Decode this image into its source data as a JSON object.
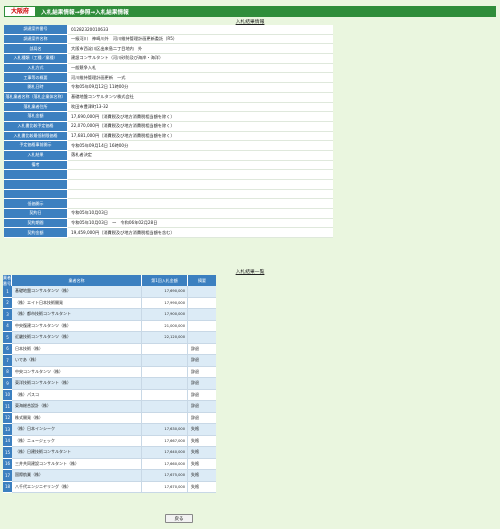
{
  "header": {
    "logo": "大阪府",
    "breadcrumb": "入札結果情報→参照→入札結果情報"
  },
  "detail": {
    "title": "入札結果情報",
    "rows": [
      {
        "label": "調達案件番号",
        "value": "01282320010633"
      },
      {
        "label": "調達案件名称",
        "value": "一級河川　神崎川外　河川維持管理計画更新委託（R5）"
      },
      {
        "label": "部局名",
        "value": "大阪市西淀川区出来島二丁目地内　外"
      },
      {
        "label": "入札種類（工種／業種）",
        "value": "建設コンサルタント（河川砂防及び海岸・海洋）"
      },
      {
        "label": "入札方式",
        "value": "一般競争入札"
      },
      {
        "label": "工事等の概要",
        "value": "河川維持管理計画更新　一式"
      },
      {
        "label": "開札日時",
        "value": "令和05年09月12日 11時00分"
      },
      {
        "label": "落札業者名称（落札企業体名称）",
        "value": "基礎地盤コンサルタンツ株式会社"
      },
      {
        "label": "落札業者住所",
        "value": "吹田市豊津町13-32"
      },
      {
        "label": "落札金額",
        "value": "17,690,000円（消費税及び地方消費税相当額を除く）"
      },
      {
        "label": "入札書比較予定価格",
        "value": "22,070,000円（消費税及び地方消費税相当額を除く）"
      },
      {
        "label": "入札書比較最低制限価格",
        "value": "17,681,000円（消費税及び地方消費税相当額を除く）"
      },
      {
        "label": "予定価格事前開示",
        "value": "令和05年09月14日 16時00分"
      },
      {
        "label": "入札結果",
        "value": "落札者決定"
      },
      {
        "label": "備考",
        "value": ""
      },
      {
        "label": "",
        "value": ""
      },
      {
        "label": "",
        "value": ""
      },
      {
        "label": "",
        "value": ""
      },
      {
        "label": "低価開示",
        "value": ""
      },
      {
        "label": "契約日",
        "value": "令和05年10月03日"
      },
      {
        "label": "契約期間",
        "value": "令和05年10月03日　～　令和06年02月28日"
      },
      {
        "label": "契約金額",
        "value": "19,459,000円（消費税及び地方消費税相当額を含む）"
      }
    ]
  },
  "results": {
    "title": "入札結果一覧",
    "headers": {
      "no": "業者番号",
      "name": "業者名称",
      "amount": "第1回入札金額",
      "summary": "摘要"
    },
    "rows": [
      {
        "no": "1",
        "name": "基礎地盤コンサルタンツ（株）",
        "amount": "17,690,000",
        "summary": ""
      },
      {
        "no": "2",
        "name": "（株）エイト日本技術開発",
        "amount": "17,990,000",
        "summary": ""
      },
      {
        "no": "3",
        "name": "（株）都市技術コンサルタント",
        "amount": "17,900,000",
        "summary": ""
      },
      {
        "no": "4",
        "name": "中央復建コンサルタンツ（株）",
        "amount": "21,000,000",
        "summary": ""
      },
      {
        "no": "5",
        "name": "近畿技術コンサルタンツ（株）",
        "amount": "22,120,000",
        "summary": ""
      },
      {
        "no": "6",
        "name": "日本技術（株）",
        "amount": "",
        "summary": "辞退"
      },
      {
        "no": "7",
        "name": "いであ（株）",
        "amount": "",
        "summary": "辞退"
      },
      {
        "no": "8",
        "name": "中央コンサルタンツ（株）",
        "amount": "",
        "summary": "辞退"
      },
      {
        "no": "9",
        "name": "東洋技術コンサルタント（株）",
        "amount": "",
        "summary": "辞退"
      },
      {
        "no": "10",
        "name": "（株）パスコ",
        "amount": "",
        "summary": "辞退"
      },
      {
        "no": "11",
        "name": "東海総合設計（株）",
        "amount": "",
        "summary": "辞退"
      },
      {
        "no": "12",
        "name": "株式開発（株）",
        "amount": "",
        "summary": "辞退"
      },
      {
        "no": "13",
        "name": "（株）日本インシーク",
        "amount": "17,630,000",
        "summary": "失格"
      },
      {
        "no": "14",
        "name": "（株）ニュージェック",
        "amount": "17,667,000",
        "summary": "失格"
      },
      {
        "no": "15",
        "name": "（株）日建技術コンサルタント",
        "amount": "17,640,000",
        "summary": "失格"
      },
      {
        "no": "16",
        "name": "三井共同建設コンサルタント（株）",
        "amount": "17,660,000",
        "summary": "失格"
      },
      {
        "no": "17",
        "name": "国際航業（株）",
        "amount": "17,675,000",
        "summary": "失格"
      },
      {
        "no": "18",
        "name": "八千代エンジニヤリング（株）",
        "amount": "17,670,000",
        "summary": "失格"
      }
    ]
  },
  "back_button": "戻る"
}
